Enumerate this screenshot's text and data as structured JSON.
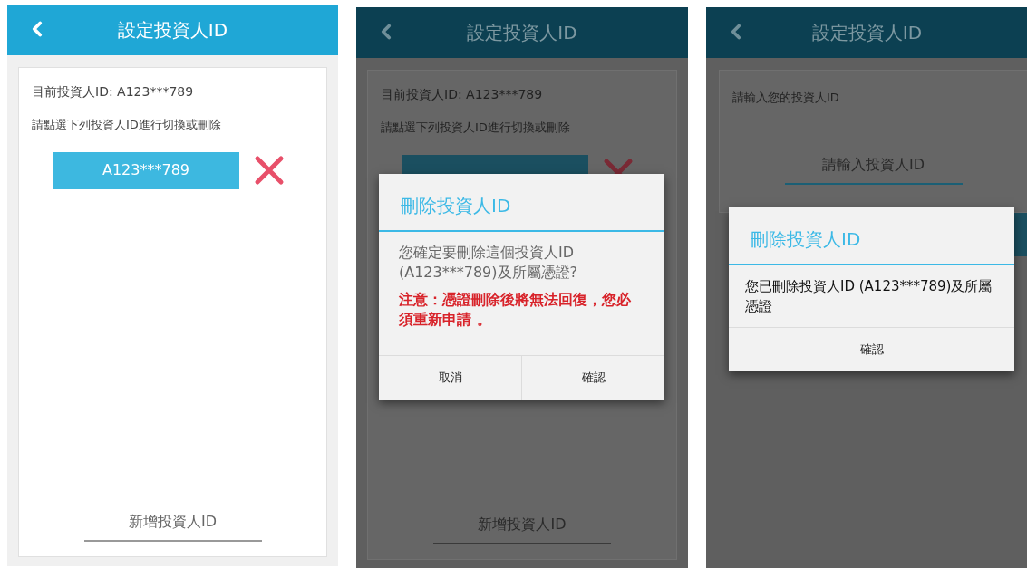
{
  "screens": [
    {
      "kind": "list",
      "dimmed": false,
      "header": {
        "title": "設定投資人ID"
      },
      "current_id": "目前投資人ID: A123***789",
      "instruction": "請點選下列投資人ID進行切換或刪除",
      "ids": [
        {
          "label": "A123***789"
        }
      ],
      "add_button": "新增投資人ID"
    },
    {
      "kind": "list",
      "dimmed": true,
      "header": {
        "title": "設定投資人ID"
      },
      "current_id": "目前投資人ID: A123***789",
      "instruction": "請點選下列投資人ID進行切換或刪除",
      "covered_id_button": true,
      "add_button": "新增投資人ID",
      "dialog": {
        "title": "刪除投資人ID",
        "message": "您確定要刪除這個投資人ID (A123***789)及所屬憑證?",
        "warning": "注意：憑證刪除後將無法回復，您必須重新申請 。",
        "buttons": [
          "取消",
          "確認"
        ]
      }
    },
    {
      "kind": "input",
      "dimmed": true,
      "header": {
        "title": "設定投資人ID"
      },
      "prompt": "請輸入您的投資人ID",
      "input": {
        "placeholder": "請輸入投資人ID"
      },
      "dialog": {
        "title": "刪除投資人ID",
        "message": "您已刪除投資人ID (A123***789)及所屬憑證",
        "buttons": [
          "確認"
        ]
      }
    }
  ]
}
